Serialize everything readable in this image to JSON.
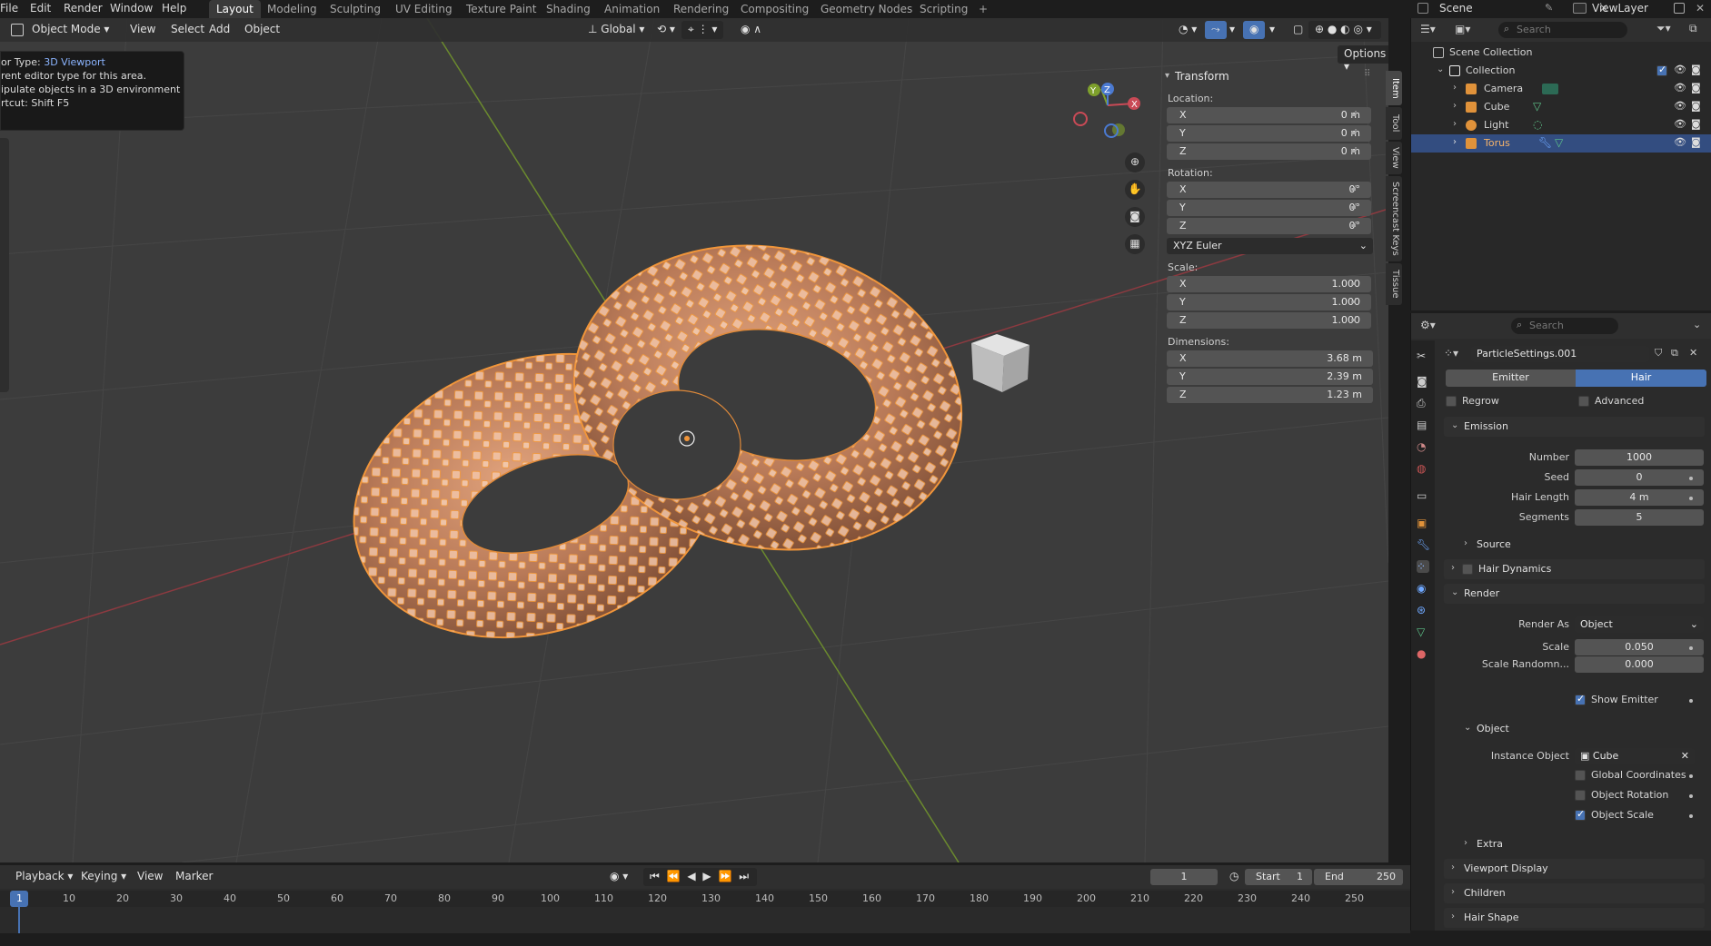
{
  "menubar": {
    "items": [
      "File",
      "Edit",
      "Render",
      "Window",
      "Help"
    ],
    "workspace_tabs": [
      "Layout",
      "Modeling",
      "Sculpting",
      "UV Editing",
      "Texture Paint",
      "Shading",
      "Animation",
      "Rendering",
      "Compositing",
      "Geometry Nodes",
      "Scripting"
    ],
    "active_tab": "Layout",
    "add_tab": "+",
    "scene_name": "Scene",
    "view_layer": "ViewLayer"
  },
  "viewport": {
    "mode": "Object Mode",
    "menus": [
      "View",
      "Select",
      "Add",
      "Object"
    ],
    "orientation": "Global",
    "options_label": "Options",
    "tooltip": {
      "line1_prefix": "or Type: ",
      "line1_value": "3D Viewport",
      "line2": "rent editor type for this area.",
      "line3": "ipulate objects in a 3D environment",
      "line4": "rtcut: Shift F5"
    },
    "gizmo": {
      "x": "X",
      "y": "Y",
      "z": "Z"
    }
  },
  "transform_panel": {
    "title": "Transform",
    "location_label": "Location:",
    "location": [
      {
        "axis": "X",
        "value": "0 m"
      },
      {
        "axis": "Y",
        "value": "0 m"
      },
      {
        "axis": "Z",
        "value": "0 m"
      }
    ],
    "rotation_label": "Rotation:",
    "rotation": [
      {
        "axis": "X",
        "value": "0°"
      },
      {
        "axis": "Y",
        "value": "0°"
      },
      {
        "axis": "Z",
        "value": "0°"
      }
    ],
    "rotation_mode": "XYZ Euler",
    "scale_label": "Scale:",
    "scale": [
      {
        "axis": "X",
        "value": "1.000"
      },
      {
        "axis": "Y",
        "value": "1.000"
      },
      {
        "axis": "Z",
        "value": "1.000"
      }
    ],
    "dimensions_label": "Dimensions:",
    "dimensions": [
      {
        "axis": "X",
        "value": "3.68 m"
      },
      {
        "axis": "Y",
        "value": "2.39 m"
      },
      {
        "axis": "Z",
        "value": "1.23 m"
      }
    ]
  },
  "sidebar_tabs": [
    "Item",
    "Tool",
    "View",
    "Screencast Keys",
    "Tissue"
  ],
  "outliner": {
    "search_placeholder": "Search",
    "scene_collection": "Scene Collection",
    "collection": "Collection",
    "objects": [
      {
        "name": "Camera",
        "color": "#e0923a"
      },
      {
        "name": "Cube",
        "color": "#e0923a"
      },
      {
        "name": "Light",
        "color": "#e0923a"
      },
      {
        "name": "Torus",
        "color": "#e0923a"
      }
    ],
    "selected": "Torus"
  },
  "properties": {
    "search_placeholder": "Search",
    "settings_name": "ParticleSettings.001",
    "type_tabs": [
      "Emitter",
      "Hair"
    ],
    "active_type": "Hair",
    "regrow_label": "Regrow",
    "advanced_label": "Advanced",
    "emission": {
      "title": "Emission",
      "fields": [
        {
          "label": "Number",
          "value": "1000"
        },
        {
          "label": "Seed",
          "value": "0"
        },
        {
          "label": "Hair Length",
          "value": "4 m"
        },
        {
          "label": "Segments",
          "value": "5"
        }
      ],
      "source_label": "Source"
    },
    "hair_dynamics_label": "Hair Dynamics",
    "render": {
      "title": "Render",
      "render_as_label": "Render As",
      "render_as_value": "Object",
      "scale_label": "Scale",
      "scale_value": "0.050",
      "scale_random_label": "Scale Randomn...",
      "scale_random_value": "0.000",
      "show_emitter_label": "Show Emitter",
      "object_sub": "Object",
      "instance_object_label": "Instance Object",
      "instance_object_value": "Cube",
      "global_coords_label": "Global Coordinates",
      "object_rotation_label": "Object Rotation",
      "object_scale_label": "Object Scale",
      "extra_label": "Extra"
    },
    "collapsed_panels": [
      "Viewport Display",
      "Children",
      "Hair Shape"
    ]
  },
  "timeline": {
    "menus": [
      "Playback",
      "Keying",
      "View",
      "Marker"
    ],
    "current_frame": "1",
    "start_label": "Start",
    "start_value": "1",
    "end_label": "End",
    "end_value": "250",
    "ticks": [
      "1",
      "10",
      "20",
      "30",
      "40",
      "50",
      "60",
      "70",
      "80",
      "90",
      "100",
      "110",
      "120",
      "130",
      "140",
      "150",
      "160",
      "170",
      "180",
      "190",
      "200",
      "210",
      "220",
      "230",
      "240",
      "250"
    ]
  },
  "colors": {
    "accent": "#4772b3",
    "selection": "#334d80",
    "object_orange": "#e0923a"
  }
}
